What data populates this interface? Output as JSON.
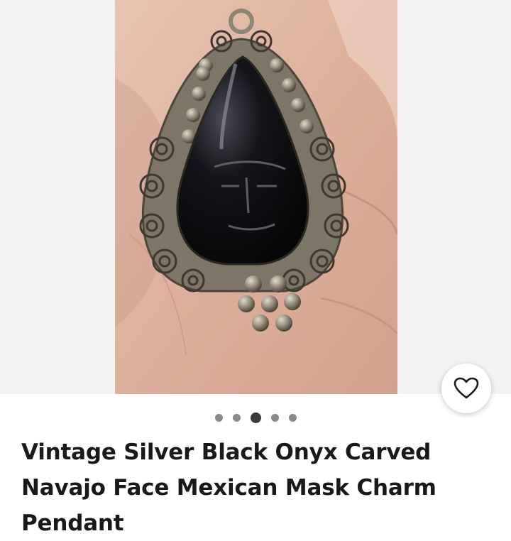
{
  "listing": {
    "title": "Vintage Silver Black Onyx Carved Navajo Face Mexican Mask Charm Pendant"
  },
  "gallery": {
    "image_subject": "silver-black-onyx-pendant-photo",
    "total_images": 5,
    "active_index": 3
  },
  "actions": {
    "favorite_icon": "heart-outline-icon"
  },
  "colors": {
    "page_background": "#ffffff",
    "gallery_background": "#f2f2f2",
    "title_text": "#191919",
    "dot_inactive": "#8a8a8a",
    "dot_active": "#3a3a3a"
  }
}
